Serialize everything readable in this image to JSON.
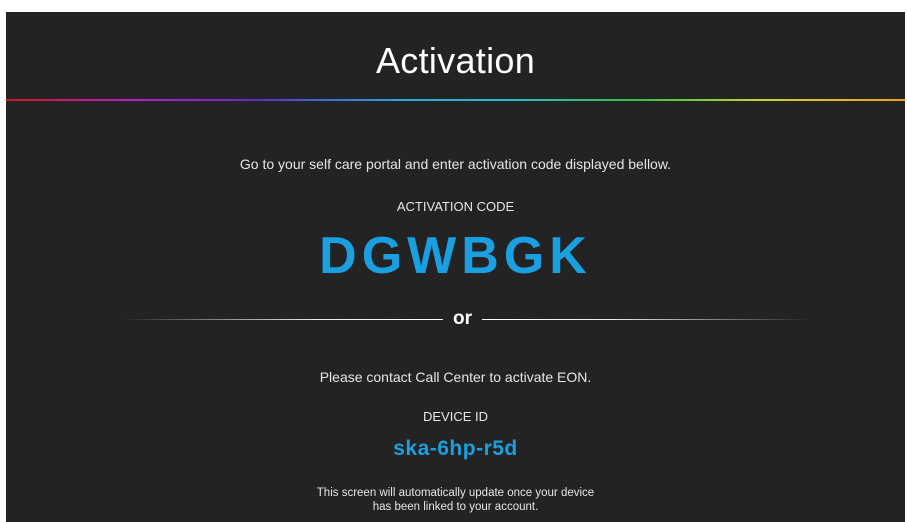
{
  "header": {
    "title": "Activation"
  },
  "activation": {
    "instruction": "Go to your self care portal and enter activation code displayed bellow.",
    "code_label": "ACTIVATION CODE",
    "code": "DGWBGK"
  },
  "separator": {
    "text": "or"
  },
  "contact": {
    "instruction": "Please contact Call Center to activate EON.",
    "device_label": "DEVICE ID",
    "device_id": "ska-6hp-r5d"
  },
  "footer": {
    "line1": "This screen will automatically update once your device",
    "line2": "has been linked to your account."
  },
  "colors": {
    "background": "#232323",
    "accent": "#1a9fe0",
    "text": "#ffffff"
  }
}
